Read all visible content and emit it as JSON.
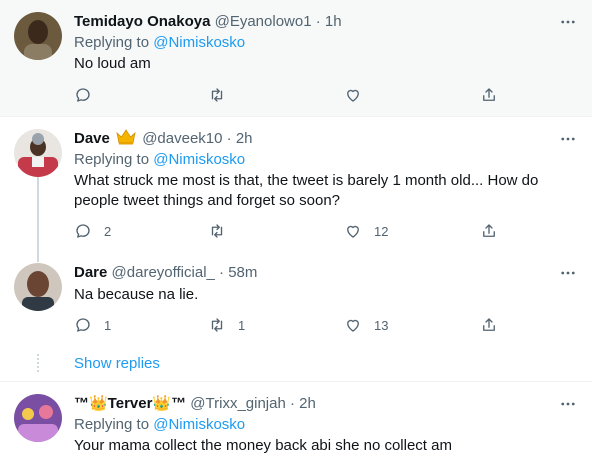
{
  "tweets": [
    {
      "name": "Temidayo Onakoya",
      "handle": "@Eyanolowo1",
      "dot": "·",
      "time": "1h",
      "replying_prefix": "Replying to",
      "replying_to": "@Nimiskosko",
      "text": "No loud am",
      "counts": {
        "reply": "",
        "retweet": "",
        "like": ""
      }
    },
    {
      "name": "Dave",
      "handle": "@daveek10",
      "dot": "·",
      "time": "2h",
      "replying_prefix": "Replying to",
      "replying_to": "@Nimiskosko",
      "text": "What struck me most is that, the tweet is barely 1 month old... How do people tweet things and forget so soon?",
      "counts": {
        "reply": "2",
        "retweet": "",
        "like": "12"
      }
    },
    {
      "name": "Dare",
      "handle": "@dareyofficial_",
      "dot": "·",
      "time": "58m",
      "text": "Na because na lie.",
      "counts": {
        "reply": "1",
        "retweet": "1",
        "like": "13"
      }
    },
    {
      "name": "™👑Terver👑™",
      "handle": "@Trixx_ginjah",
      "dot": "·",
      "time": "2h",
      "replying_prefix": "Replying to",
      "replying_to": "@Nimiskosko",
      "text": "Your mama collect the money back abi she no collect am"
    }
  ],
  "show_replies": "Show replies",
  "icons": {
    "reply": "reply-icon",
    "retweet": "retweet-icon",
    "like": "like-icon",
    "share": "share-icon",
    "more": "more-icon",
    "crown": "crown-emoji-icon"
  },
  "colors": {
    "accent": "#1d9bf0",
    "secondary_text": "#536471",
    "dim_background": "#f7f9f9",
    "crown": "#f4b400"
  }
}
